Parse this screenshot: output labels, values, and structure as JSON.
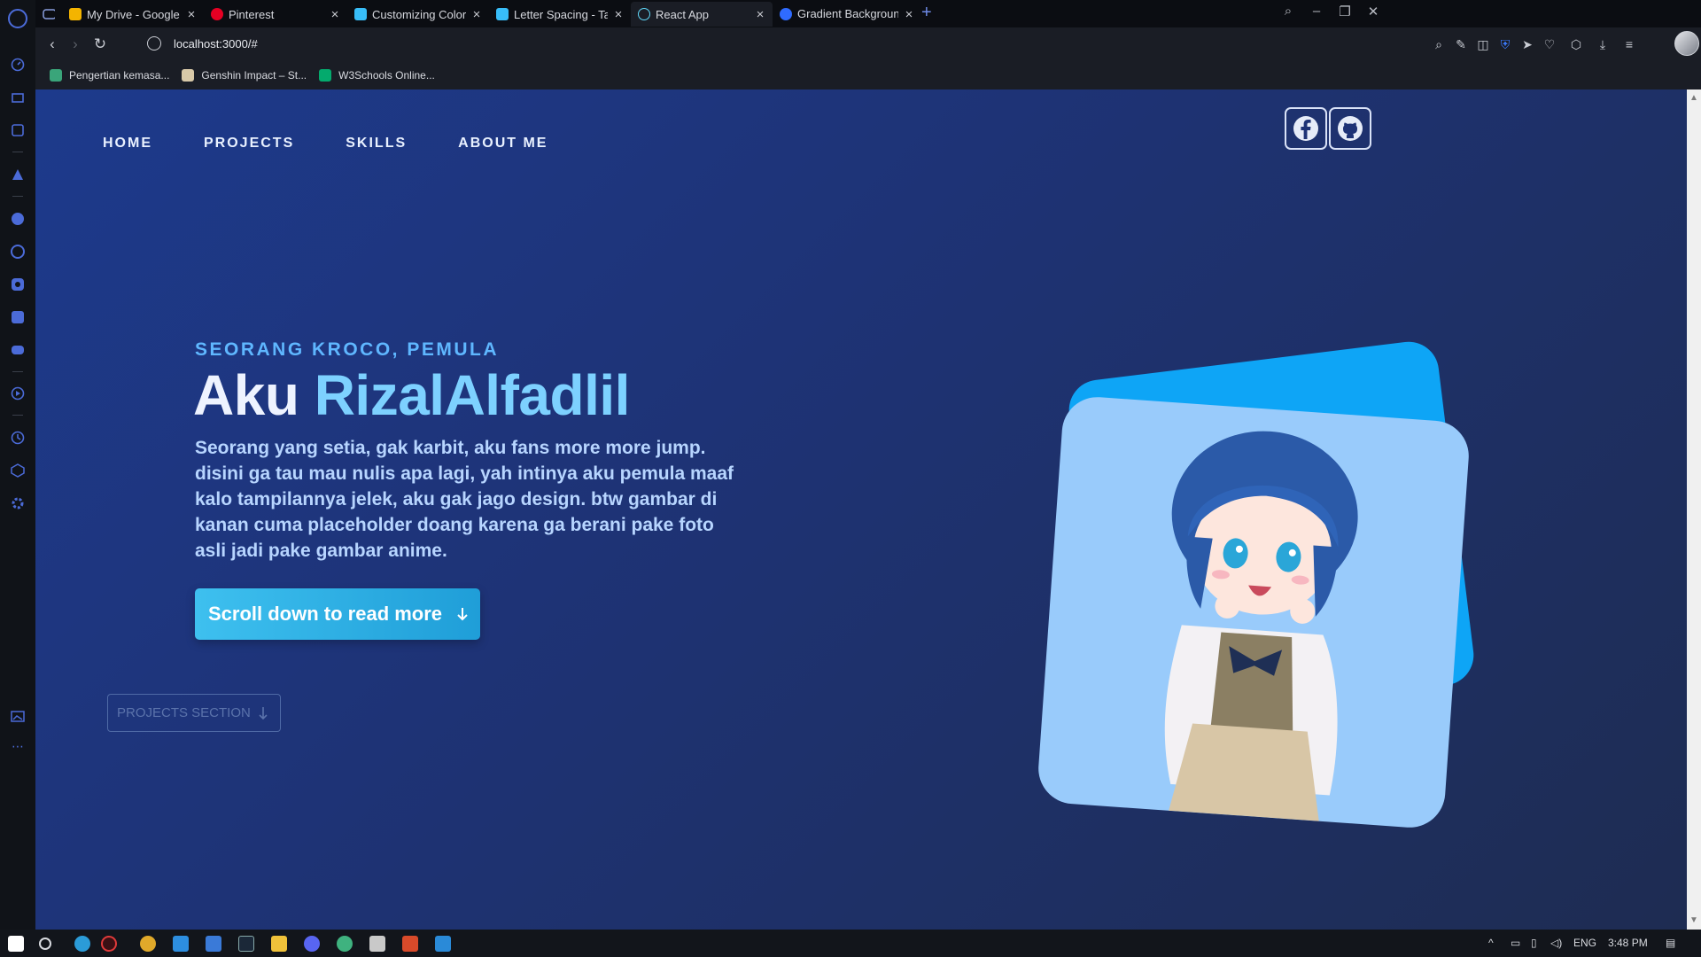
{
  "browser": {
    "tabs": [
      {
        "title": "My Drive - Google Drive",
        "icon": "google-drive-icon",
        "color": "#f4b400"
      },
      {
        "title": "Pinterest",
        "icon": "pinterest-icon",
        "color": "#e60023"
      },
      {
        "title": "Customizing Colors - Tailwi",
        "icon": "tailwind-icon",
        "color": "#38bdf8"
      },
      {
        "title": "Letter Spacing - Tailwind C",
        "icon": "tailwind-icon",
        "color": "#38bdf8"
      },
      {
        "title": "React App",
        "icon": "react-icon",
        "color": "#61dafb",
        "active": true
      },
      {
        "title": "Gradient Backgrounds – 🌈",
        "icon": "gradient-icon",
        "color": "#2f6bff"
      }
    ],
    "url": "localhost:3000/#",
    "bookmarks": [
      {
        "title": "Pengertian kemasa...",
        "icon": "bookmark-green-icon",
        "color": "#3aa57a"
      },
      {
        "title": "Genshin Impact – St...",
        "icon": "genshin-icon",
        "color": "#d8c9a8"
      },
      {
        "title": "W3Schools Online...",
        "icon": "w3schools-icon",
        "color": "#04aa6d"
      }
    ]
  },
  "site": {
    "nav": [
      "HOME",
      "PROJECTS",
      "SKILLS",
      "ABOUT ME"
    ],
    "tagline": "SEORANG KROCO, PEMULA",
    "headline_prefix": "Aku ",
    "headline_name": "RizalAlfadlil",
    "description": "Seorang yang setia, gak karbit, aku fans more more jump. disini ga tau mau nulis apa lagi, yah intinya aku pemula maaf kalo tampilannya jelek, aku gak jago design. btw gambar di kanan cuma placeholder doang karena ga berani pake foto asli jadi pake gambar anime.",
    "cta_label": "Scroll down to read more",
    "projects_label": "PROJECTS SECTION",
    "colors": {
      "accent": "#7dd1ff",
      "cta": "#3ec0ef",
      "card_back": "#0ea5f6",
      "card_front": "#99cbfb"
    }
  },
  "taskbar": {
    "lang": "ENG",
    "time": "3:48 PM"
  }
}
